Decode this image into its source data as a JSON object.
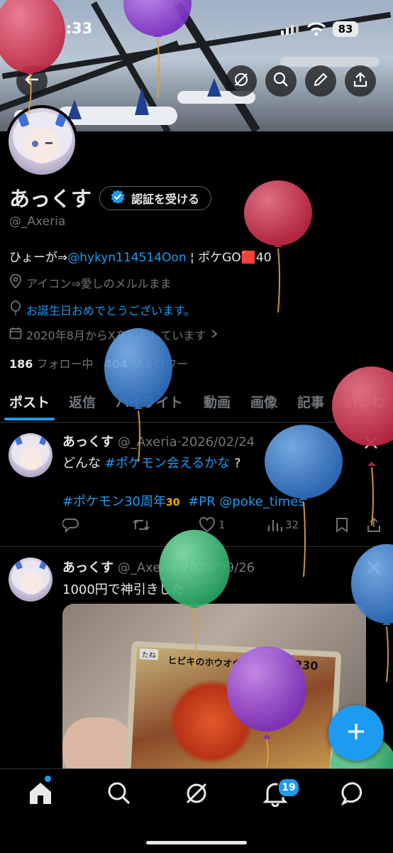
{
  "status_bar": {
    "time": "1:33",
    "battery": "83"
  },
  "profile": {
    "name": "あっくす",
    "verify_button": "認証を受ける",
    "handle": "@_Axeria",
    "bio_prefix": "ひょーが⇒",
    "bio_link": "@hykyn114514Oon",
    "bio_suffix": " ¦ ポケGO🟥40",
    "location": "アイコン⇒愛しのメルルまま",
    "birthday": "お誕生日おめでとうございます。",
    "joined": "2020年8月からXを利用しています",
    "following_count": "186",
    "following_label": "フォロー中",
    "followers_count": "404",
    "followers_label": "フォロワー"
  },
  "tabs": [
    "ポスト",
    "返信",
    "ハイライト",
    "動画",
    "画像",
    "記事",
    "いいね"
  ],
  "posts": [
    {
      "name": "あっくす",
      "handle": "@_Axeria",
      "date": "2026/02/24",
      "text1": "どんな",
      "hashtag1": "#ポケモン会えるかな",
      "text2": " ?",
      "hashtag2": "#ポケモン30周年",
      "emoji": "30",
      "hashtag3": "#PR",
      "mention": "@poke_times",
      "likes": "1",
      "views": "32"
    },
    {
      "name": "あっくす",
      "handle": "@_Axeria",
      "date": "2025/09/26",
      "text": "1000円で神引きした",
      "card_name": "ヒビキのホウオウ",
      "card_tag": "たね",
      "card_hp": "230"
    }
  ],
  "notifications_badge": "19",
  "icons": [
    "back-arrow-icon",
    "grok-icon",
    "search-icon",
    "edit-icon",
    "share-icon",
    "verified-icon",
    "location-icon",
    "balloon-icon",
    "calendar-icon",
    "chevron-right-icon",
    "reply-icon",
    "retweet-icon",
    "heart-icon",
    "views-icon",
    "bookmark-icon",
    "x-logo-icon",
    "home-icon",
    "notifications-icon",
    "messages-icon",
    "compose-icon"
  ],
  "colors": {
    "accent": "#1d9bf0",
    "background": "#000000",
    "muted": "#71767b",
    "text": "#e7e9ea"
  }
}
